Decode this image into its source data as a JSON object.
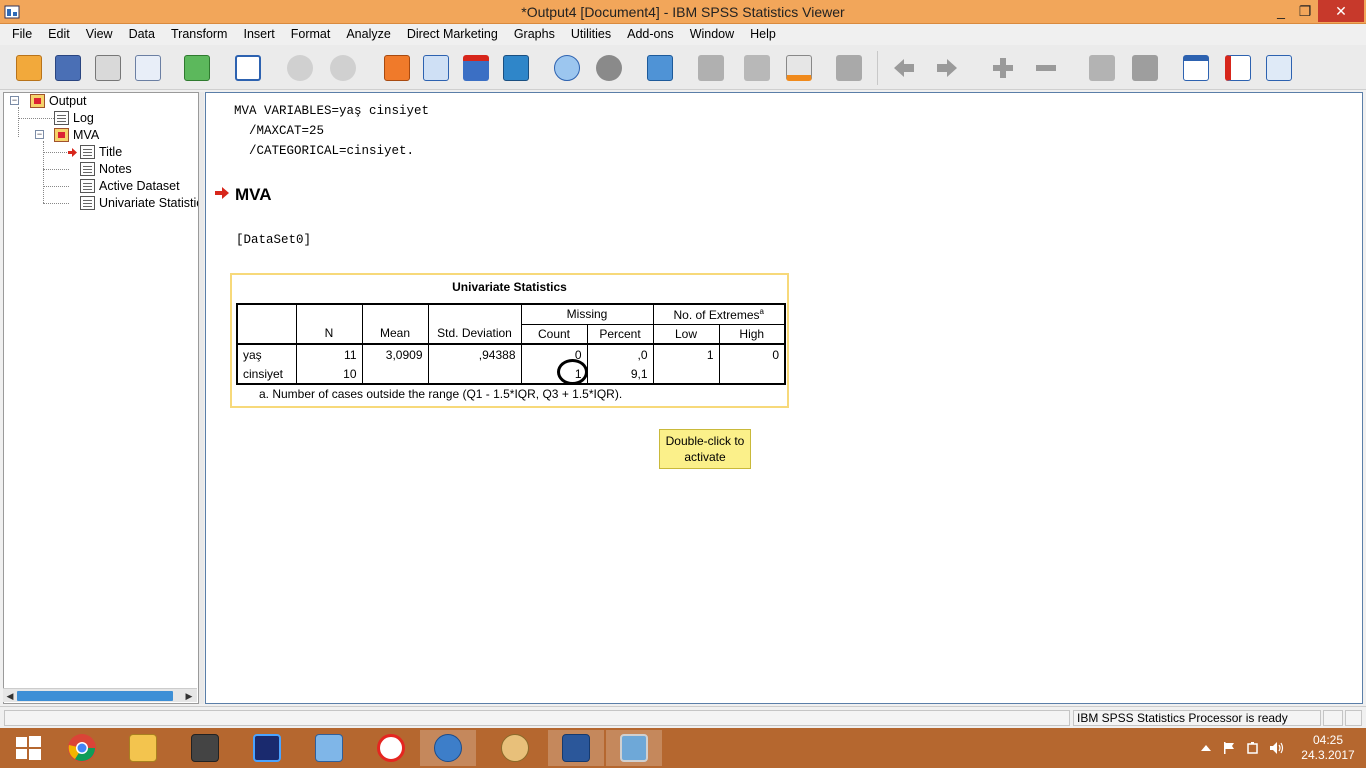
{
  "window": {
    "title": "*Output4 [Document4] - IBM SPSS Statistics Viewer",
    "minimize": "_",
    "maximize": "❐",
    "close": "✕"
  },
  "menu": [
    "File",
    "Edit",
    "View",
    "Data",
    "Transform",
    "Insert",
    "Format",
    "Analyze",
    "Direct Marketing",
    "Graphs",
    "Utilities",
    "Add-ons",
    "Window",
    "Help"
  ],
  "toolbar": {
    "icons": [
      "open-icon",
      "save-icon",
      "print-icon",
      "print-preview-icon",
      "export-icon",
      "recall-dialog-icon",
      "undo-icon",
      "redo-icon",
      "goto-data-icon",
      "goto-case-icon",
      "goto-variable-icon",
      "variables-icon",
      "designate-window-icon",
      "show-all-variables-icon",
      "use-variable-sets-icon",
      "select-cases-icon",
      "value-labels-icon",
      "insert-output-icon",
      "insert-text-icon",
      "insert-title-icon",
      "create-chart-icon",
      "expand-icon",
      "back-icon",
      "forward-icon",
      "show-icon",
      "hide-icon",
      "promote-icon",
      "demote-icon",
      "designate-icon",
      "sort-icon",
      "outline-icon"
    ]
  },
  "outline": {
    "items": [
      {
        "label": "Output",
        "icon": "output-book-icon",
        "toggle": "−"
      },
      {
        "label": "Log",
        "icon": "log-icon"
      },
      {
        "label": "MVA",
        "icon": "procedure-book-icon",
        "toggle": "−"
      },
      {
        "label": "Title",
        "icon": "title-icon"
      },
      {
        "label": "Notes",
        "icon": "notes-icon"
      },
      {
        "label": "Active Dataset",
        "icon": "dataset-icon"
      },
      {
        "label": "Univariate Statistic",
        "icon": "table-icon"
      }
    ],
    "scroll_left": "◀",
    "scroll_right": "▶"
  },
  "content": {
    "syntax_lines": [
      "MVA VARIABLES=yaş cinsiyet",
      "  /MAXCAT=25",
      "  /CATEGORICAL=cinsiyet."
    ],
    "heading": "MVA",
    "dataset": "[DataSet0]",
    "table": {
      "title": "Univariate Statistics",
      "col_n": "N",
      "col_mean": "Mean",
      "col_sd": "Std. Deviation",
      "group_missing": "Missing",
      "col_count": "Count",
      "col_percent": "Percent",
      "group_extremes": "No. of Extremes",
      "extremes_sup": "a",
      "col_low": "Low",
      "col_high": "High",
      "rows": [
        {
          "name": "yaş",
          "n": "11",
          "mean": "3,0909",
          "sd": ",94388",
          "count": "0",
          "percent": ",0",
          "low": "1",
          "high": "0"
        },
        {
          "name": "cinsiyet",
          "n": "10",
          "mean": "",
          "sd": "",
          "count": "1",
          "percent": "9,1",
          "low": "",
          "high": ""
        }
      ],
      "footnote": "a. Number of cases outside the range (Q1 - 1.5*IQR, Q3 + 1.5*IQR)."
    },
    "tooltip_line1": "Double-click to",
    "tooltip_line2": "activate"
  },
  "status": {
    "processor": "IBM SPSS Statistics Processor is ready"
  },
  "taskbar": {
    "apps": [
      "windows-start-icon",
      "chrome-icon",
      "file-explorer-icon",
      "truck-game-icon",
      "photo-app-icon",
      "network-app-icon",
      "yandex-icon",
      "spss-icon",
      "paint-icon",
      "word-icon",
      "image-viewer-icon"
    ],
    "time": "04:25",
    "date": "24.3.2017"
  },
  "colors": {
    "titlebar": "#f2a65a",
    "taskbar": "#b5672f",
    "pivot_border": "#f7d97a",
    "tooltip": "#fbf08a",
    "accent_red": "#d7261b"
  }
}
